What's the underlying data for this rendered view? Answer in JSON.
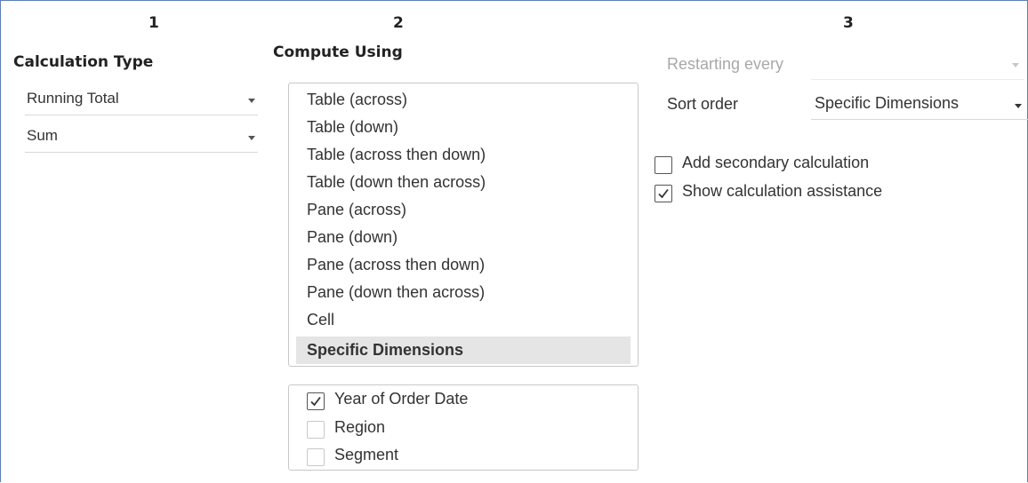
{
  "columns": [
    {
      "number": "1"
    },
    {
      "number": "2"
    },
    {
      "number": "3"
    }
  ],
  "col1": {
    "title": "Calculation Type",
    "calc_type": "Running Total",
    "aggregation": "Sum"
  },
  "col2": {
    "title": "Compute Using",
    "options": [
      "Table (across)",
      "Table (down)",
      "Table (across then down)",
      "Table (down then across)",
      "Pane (across)",
      "Pane (down)",
      "Pane (across then down)",
      "Pane (down then across)",
      "Cell",
      "Specific Dimensions"
    ],
    "selected_option": "Specific Dimensions",
    "dimensions": [
      {
        "label": "Year of Order Date",
        "checked": true
      },
      {
        "label": "Region",
        "checked": false
      },
      {
        "label": "Segment",
        "checked": false
      }
    ]
  },
  "col3": {
    "restarting_label": "Restarting every",
    "restarting_value": "",
    "sort_label": "Sort order",
    "sort_value": "Specific Dimensions",
    "secondary_calc": {
      "label": "Add secondary calculation",
      "checked": false
    },
    "calc_assist": {
      "label": "Show calculation assistance",
      "checked": true
    }
  },
  "colors": {
    "frame_border": "#5b7fb8",
    "selected_bg": "#e5e5e5",
    "disabled_text": "#a8a8a8"
  }
}
